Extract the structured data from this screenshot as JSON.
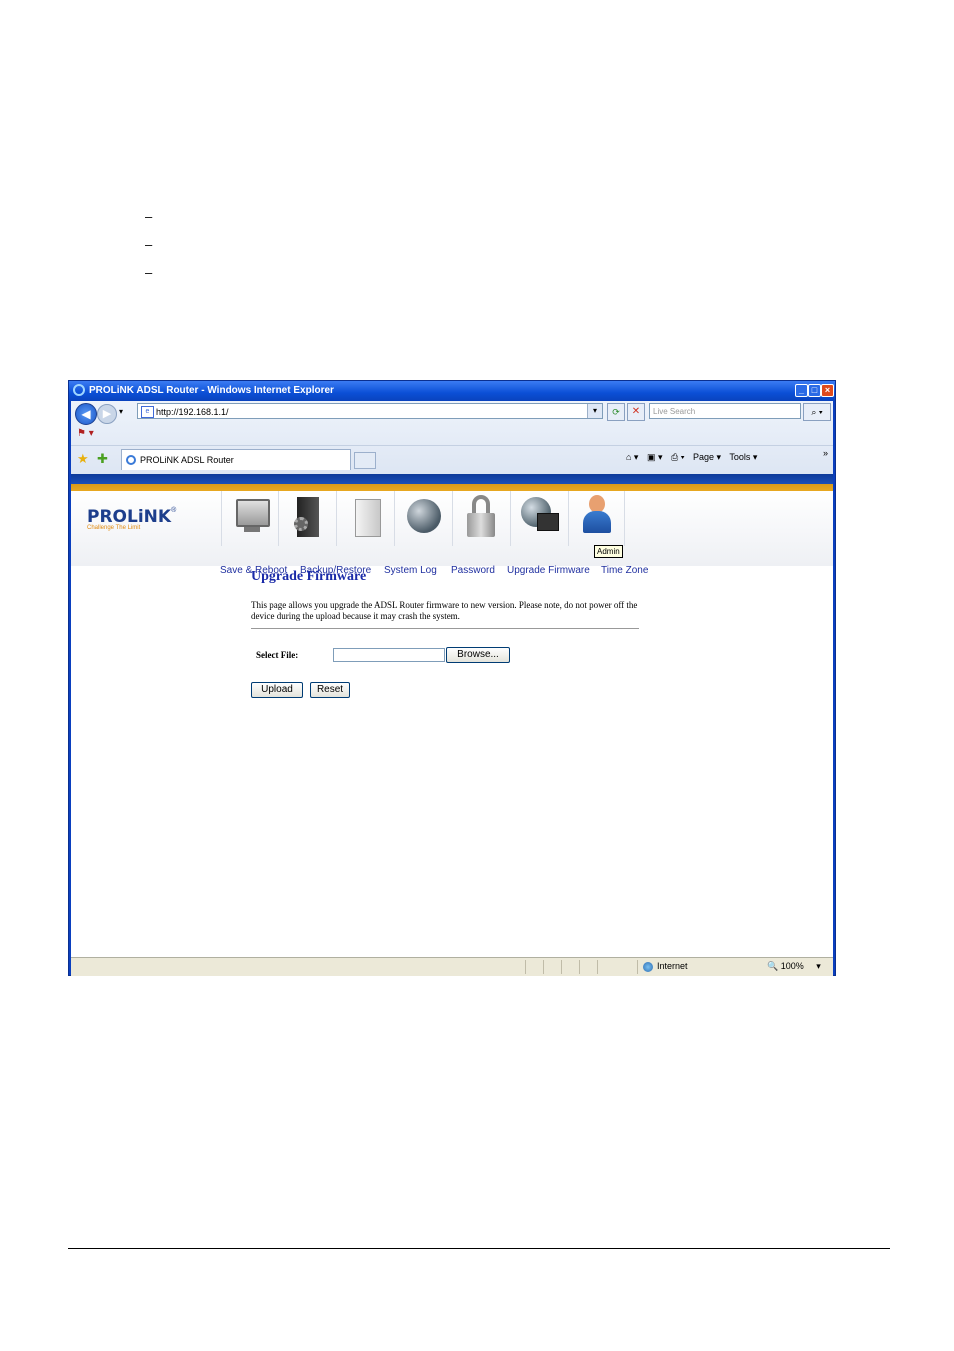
{
  "doc": {
    "bullets": [
      "–",
      "–",
      "–"
    ]
  },
  "window": {
    "title": "PROLiNK ADSL Router - Windows Internet Explorer",
    "min_label": "_",
    "max_label": "□",
    "close_label": "×"
  },
  "toolbar": {
    "back_icon": "◀",
    "forward_icon": "▶",
    "dropdown_icon": "▾",
    "address": "http://192.168.1.1/",
    "address_icon": "e",
    "address_dropdown": "▾",
    "refresh_icon": "⟳",
    "stop_icon": "✕",
    "search_placeholder": "Live Search",
    "search_icon": "⌕ ▾",
    "links_icon": "⚑ ▾",
    "fav_star": "★",
    "add_fav": "✚",
    "tab_label": "PROLiNK ADSL Router",
    "home": "⌂ ▾",
    "feeds": "▣ ▾",
    "print": "⎙ ▾",
    "page_menu": "Page ▾",
    "tools_menu": "Tools ▾",
    "chevron": "»"
  },
  "router": {
    "logo": "PROLiNK",
    "logo_reg": "®",
    "logo_tagline": "Challenge The Limit",
    "admin_tooltip": "Admin",
    "menu": {
      "save_reboot": "Save & Reboot",
      "backup_restore": "Backup/Restore",
      "system_log": "System Log",
      "password": "Password",
      "upgrade_firmware": "Upgrade Firmware",
      "time_zone": "Time Zone"
    },
    "page_title": "Upgrade Firmware",
    "description": "This page allows you upgrade the ADSL Router firmware to new version. Please note, do not power off the device during the upload because it may crash the system.",
    "select_file_label": "Select File:",
    "browse_label": "Browse...",
    "upload_label": "Upload",
    "reset_label": "Reset"
  },
  "statusbar": {
    "zone": "Internet",
    "zoom": "100%",
    "zoom_icon": "🔍",
    "zoom_dropdown": "▾"
  },
  "colors": {
    "title_bar": "#0b4fd6",
    "menu_link": "#2030a0",
    "page_title": "#1a2aa8",
    "logo": "#1d3e8c",
    "tagline": "#e08a10"
  }
}
